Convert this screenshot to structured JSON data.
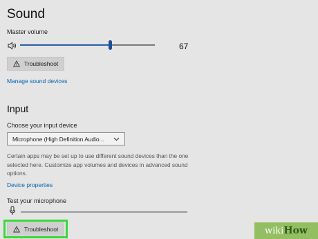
{
  "sound": {
    "title": "Sound",
    "master_volume_label": "Master volume",
    "master_volume_value": "67",
    "master_volume_level": 0.67,
    "troubleshoot_label": "Troubleshoot",
    "manage_devices_link": "Manage sound devices"
  },
  "input": {
    "title": "Input",
    "choose_device_label": "Choose your input device",
    "device_selected": "Microphone (High Definition Audio...",
    "description": "Certain apps may be set up to use different sound devices than the one selected here. Customize app volumes and devices in advanced sound options.",
    "device_properties_link": "Device properties",
    "test_mic_label": "Test your microphone",
    "troubleshoot_label": "Troubleshoot"
  },
  "watermark": {
    "wiki": "wiki",
    "how": "How"
  },
  "colors": {
    "accent": "#2a5fa8",
    "link": "#0063b1",
    "highlight": "#38d93a",
    "background": "#e5e5e5"
  },
  "icons": {
    "speaker": "speaker-icon",
    "warning": "warning-icon",
    "microphone": "microphone-icon",
    "dropdown": "chevron-down-icon"
  }
}
